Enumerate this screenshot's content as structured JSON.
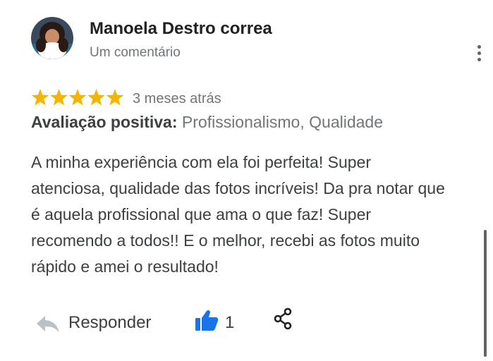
{
  "review": {
    "author_name": "Manoela Destro correa",
    "author_meta": "Um comentário",
    "rating": 5,
    "rating_max": 5,
    "time_ago": "3 meses atrás",
    "tags_label": "Avaliação positiva:",
    "tags_value": "Profissionalismo, Qualidade",
    "text": "A minha experiência com ela foi perfeita! Super atenciosa, qualidade das fotos incríveis! Da pra notar que é aquela profissional que ama o que faz! Super recomendo a todos!! E o melhor, recebi as fotos muito rápido e amei o resultado!"
  },
  "actions": {
    "reply_label": "Responder",
    "like_count": "1",
    "reply_icon": "reply-arrow-icon",
    "like_icon": "thumbs-up-icon",
    "share_icon": "share-icon",
    "more_icon": "more-vert-icon"
  },
  "colors": {
    "star": "#f4b400",
    "like": "#1a73e8",
    "reply_icon": "#bdc1c6",
    "muted_text": "#70757a"
  }
}
